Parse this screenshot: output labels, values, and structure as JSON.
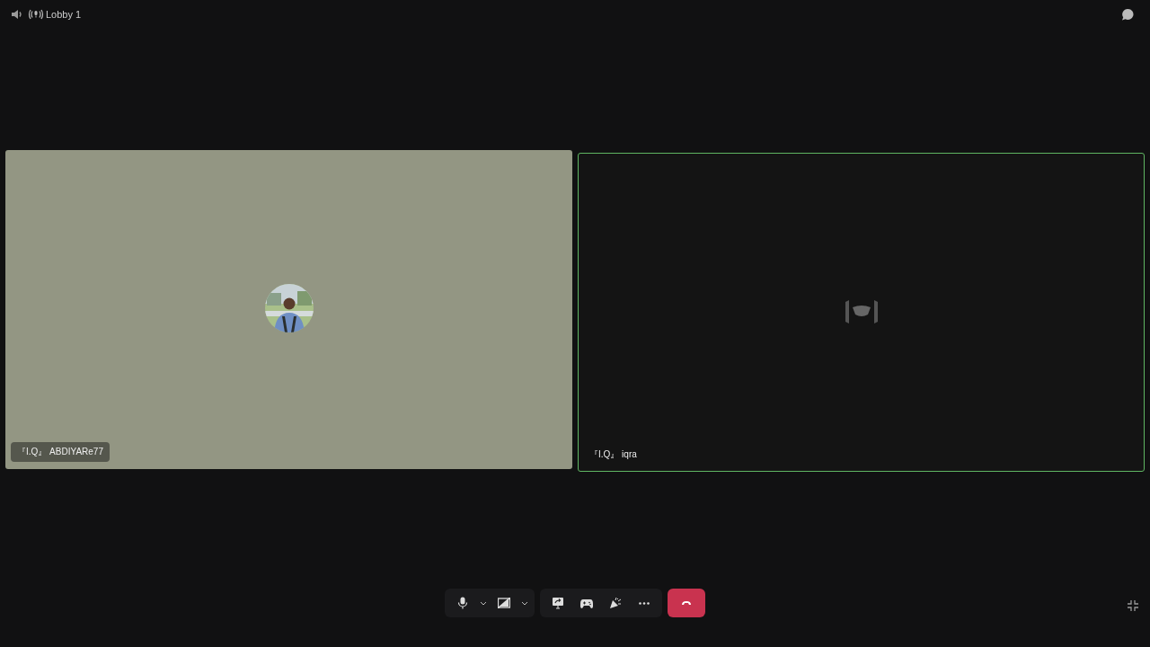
{
  "channel": {
    "name": "Lobby 1"
  },
  "tiles": [
    {
      "kind": "avatar",
      "name": "『I.Q』 ABDIYARe77",
      "speaking": false
    },
    {
      "kind": "icon",
      "name": "『I.Q』 iqra",
      "speaking": true
    }
  ],
  "controls": {
    "mic_muted": false,
    "camera_off": true
  }
}
